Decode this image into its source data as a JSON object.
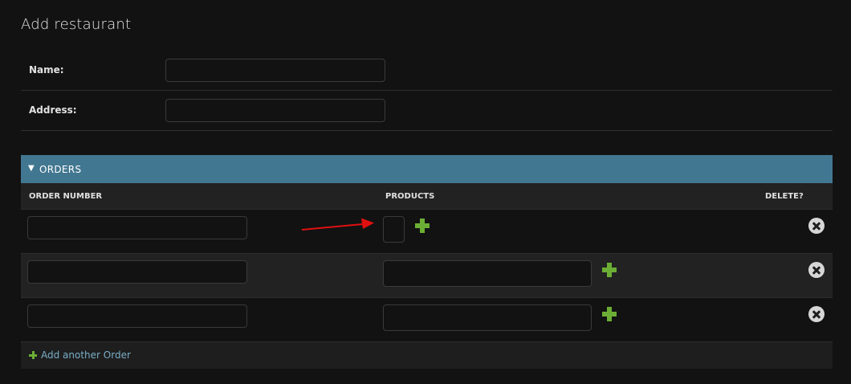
{
  "page": {
    "title": "Add restaurant"
  },
  "form": {
    "name_label": "Name:",
    "name_value": "",
    "address_label": "Address:",
    "address_value": ""
  },
  "orders": {
    "header_title": "ORDERS",
    "header_toggle_icon": "triangle-down-icon",
    "columns": {
      "order_number": "ORDER NUMBER",
      "products": "PRODUCTS",
      "delete": "DELETE?"
    },
    "rows": [
      {
        "order_number": "",
        "products": ""
      },
      {
        "order_number": "",
        "products": ""
      },
      {
        "order_number": "",
        "products": ""
      }
    ],
    "add_another_label": "Add another Order"
  },
  "colors": {
    "header_bg": "#427791",
    "accent_green": "#6cae35",
    "link_blue": "#79aec8",
    "annotation_arrow": "#e01010"
  },
  "icons": {
    "add": "plus-icon",
    "delete": "delete-x-circle-icon",
    "annotation": "red-arrow-icon"
  }
}
